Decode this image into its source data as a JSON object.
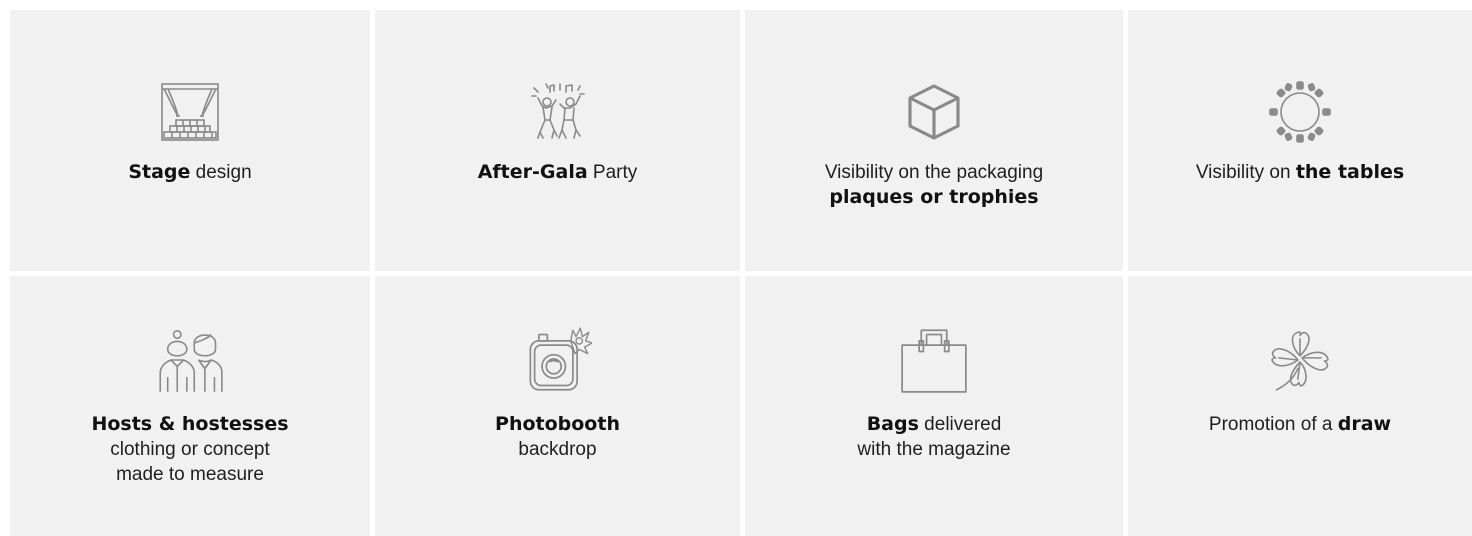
{
  "features": [
    {
      "icon": "stage-icon",
      "bold": "Stage",
      "rest": " design"
    },
    {
      "icon": "dancing-people-icon",
      "bold": "After-Gala",
      "rest": " Party"
    },
    {
      "icon": "box-icon",
      "line1": "Visibility on the packaging",
      "bold2": "plaques or trophies"
    },
    {
      "icon": "round-table-icon",
      "pre": "Visibility on ",
      "bold": "the tables"
    },
    {
      "icon": "hosts-icon",
      "bold": "Hosts & hostesses",
      "line2": "clothing or concept",
      "line3": "made to measure"
    },
    {
      "icon": "photo-camera-icon",
      "bold": "Photobooth",
      "line2": "backdrop"
    },
    {
      "icon": "bag-icon",
      "bold": "Bags",
      "rest": " delivered",
      "line2": "with the magazine"
    },
    {
      "icon": "four-leaf-clover-icon",
      "pre": "Promotion of a ",
      "bold": "draw"
    }
  ]
}
